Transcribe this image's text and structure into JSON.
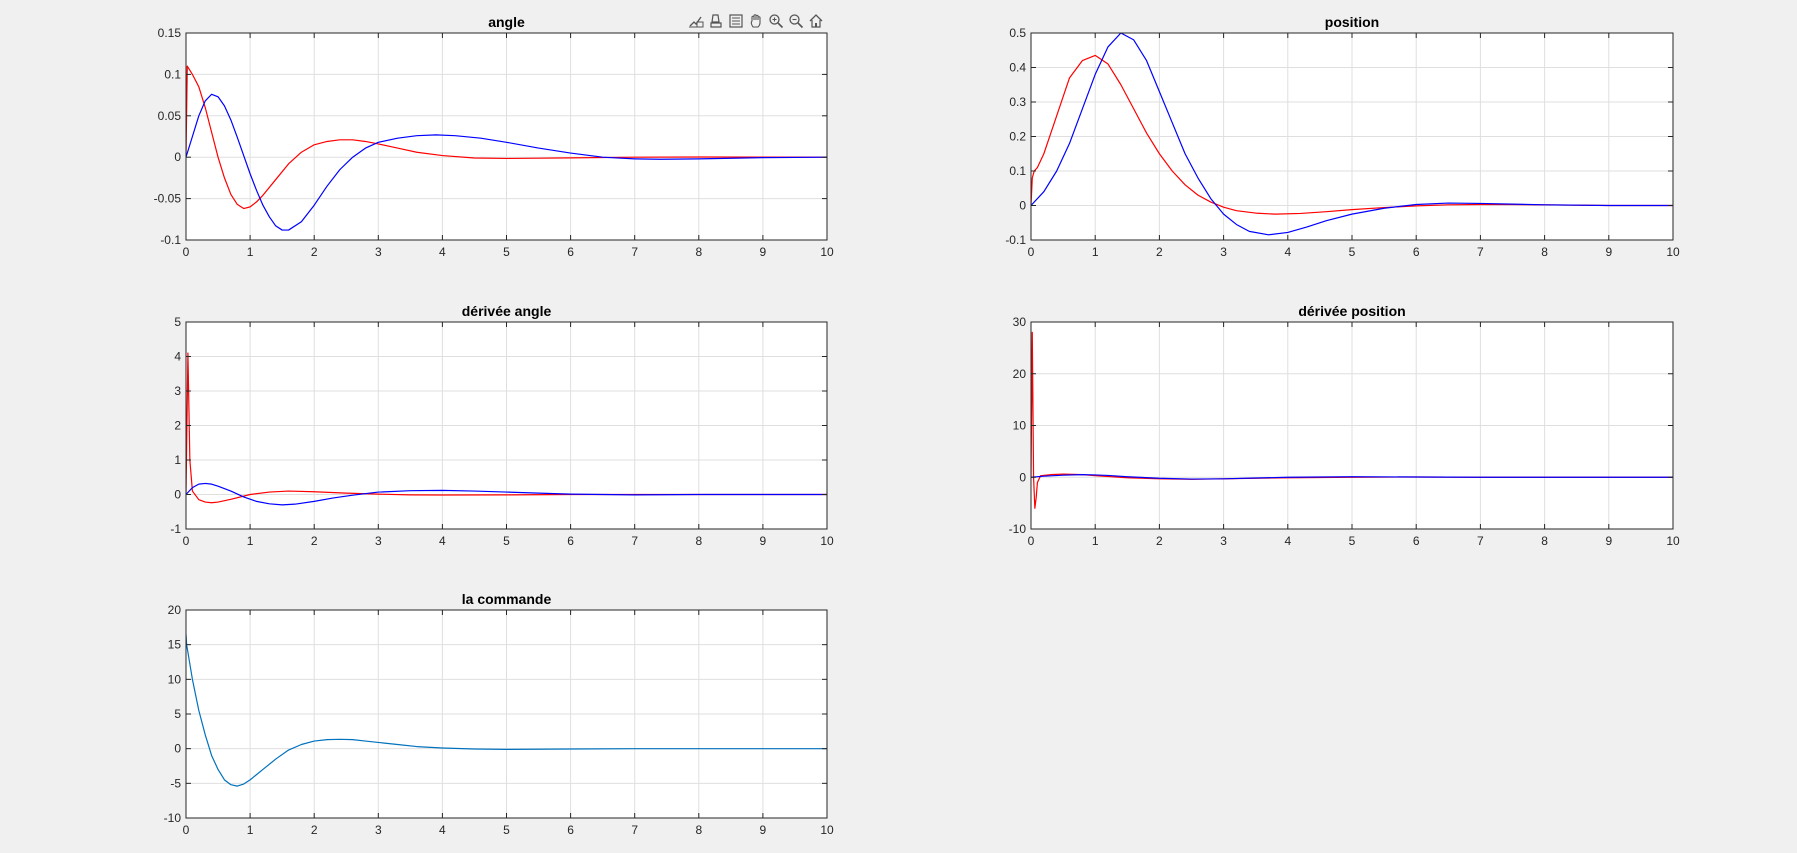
{
  "toolbar": {
    "icons": [
      "data-tips-icon",
      "brush-icon",
      "legend-icon",
      "pan-icon",
      "zoom-in-icon",
      "zoom-out-icon",
      "home-icon"
    ]
  },
  "colors": {
    "red_series": "#ff0000",
    "blue_series": "#0000ff",
    "command_series": "#0072bd",
    "grid": "#dfdfdf",
    "axes_bg": "#ffffff",
    "figure_bg": "#f0f0f0"
  },
  "chart_data": [
    {
      "id": "angle",
      "type": "line",
      "title": "angle",
      "xlabel": "",
      "ylabel": "",
      "xlim": [
        0,
        10
      ],
      "ylim": [
        -0.1,
        0.15
      ],
      "xticks": [
        0,
        1,
        2,
        3,
        4,
        5,
        6,
        7,
        8,
        9,
        10
      ],
      "yticks": [
        -0.1,
        -0.05,
        0,
        0.05,
        0.1,
        0.15
      ],
      "ytick_labels": [
        "-0.1",
        "-0.05",
        "0",
        "0.05",
        "0.1",
        "0.15"
      ],
      "grid": true,
      "series": [
        {
          "color": "#ff0000",
          "x": [
            0,
            0.02,
            0.1,
            0.2,
            0.3,
            0.4,
            0.5,
            0.6,
            0.7,
            0.8,
            0.9,
            1.0,
            1.1,
            1.2,
            1.4,
            1.6,
            1.8,
            2.0,
            2.2,
            2.4,
            2.6,
            2.8,
            3.0,
            3.3,
            3.6,
            4.0,
            4.5,
            5.0,
            5.5,
            6.0,
            7.0,
            8.0,
            9.0,
            10.0
          ],
          "y": [
            0,
            0.11,
            0.1,
            0.085,
            0.06,
            0.03,
            0.0,
            -0.025,
            -0.045,
            -0.057,
            -0.062,
            -0.06,
            -0.054,
            -0.046,
            -0.027,
            -0.008,
            0.006,
            0.015,
            0.019,
            0.021,
            0.021,
            0.019,
            0.016,
            0.011,
            0.006,
            0.002,
            -0.001,
            -0.0015,
            -0.0012,
            -0.0008,
            0.0,
            0.0002,
            0.0001,
            0.0
          ]
        },
        {
          "color": "#0000ff",
          "x": [
            0,
            0.1,
            0.2,
            0.3,
            0.4,
            0.5,
            0.6,
            0.7,
            0.8,
            0.9,
            1.0,
            1.1,
            1.2,
            1.3,
            1.4,
            1.5,
            1.6,
            1.8,
            2.0,
            2.2,
            2.4,
            2.6,
            2.8,
            3.0,
            3.3,
            3.6,
            3.9,
            4.2,
            4.6,
            5.0,
            5.5,
            6.0,
            6.5,
            7.0,
            7.4,
            8.0,
            9.0,
            10.0
          ],
          "y": [
            0,
            0.025,
            0.05,
            0.068,
            0.076,
            0.073,
            0.062,
            0.045,
            0.024,
            0.002,
            -0.02,
            -0.04,
            -0.058,
            -0.072,
            -0.083,
            -0.088,
            -0.088,
            -0.078,
            -0.058,
            -0.035,
            -0.015,
            0.0,
            0.011,
            0.018,
            0.023,
            0.026,
            0.027,
            0.026,
            0.023,
            0.018,
            0.011,
            0.005,
            0.0,
            -0.002,
            -0.0025,
            -0.002,
            -0.0005,
            0.0
          ]
        }
      ]
    },
    {
      "id": "position",
      "type": "line",
      "title": "position",
      "xlabel": "",
      "ylabel": "",
      "xlim": [
        0,
        10
      ],
      "ylim": [
        -0.1,
        0.5
      ],
      "xticks": [
        0,
        1,
        2,
        3,
        4,
        5,
        6,
        7,
        8,
        9,
        10
      ],
      "yticks": [
        -0.1,
        0,
        0.1,
        0.2,
        0.3,
        0.4,
        0.5
      ],
      "ytick_labels": [
        "-0.1",
        "0",
        "0.1",
        "0.2",
        "0.3",
        "0.4",
        "0.5"
      ],
      "grid": true,
      "series": [
        {
          "color": "#ff0000",
          "x": [
            0,
            0.02,
            0.05,
            0.1,
            0.2,
            0.4,
            0.6,
            0.8,
            1.0,
            1.2,
            1.4,
            1.6,
            1.8,
            2.0,
            2.2,
            2.4,
            2.6,
            2.8,
            3.0,
            3.2,
            3.5,
            3.8,
            4.2,
            4.6,
            5.0,
            5.5,
            6.0,
            6.5,
            7.0,
            7.5,
            8.0,
            9.0,
            10.0
          ],
          "y": [
            0,
            0.08,
            0.1,
            0.11,
            0.15,
            0.26,
            0.37,
            0.42,
            0.435,
            0.41,
            0.35,
            0.28,
            0.21,
            0.15,
            0.1,
            0.06,
            0.03,
            0.01,
            -0.005,
            -0.015,
            -0.022,
            -0.025,
            -0.023,
            -0.018,
            -0.012,
            -0.006,
            -0.001,
            0.002,
            0.003,
            0.003,
            0.002,
            0.0,
            0.0
          ]
        },
        {
          "color": "#0000ff",
          "x": [
            0,
            0.2,
            0.4,
            0.6,
            0.8,
            1.0,
            1.2,
            1.4,
            1.6,
            1.8,
            2.0,
            2.2,
            2.4,
            2.6,
            2.8,
            3.0,
            3.2,
            3.4,
            3.7,
            4.0,
            4.3,
            4.6,
            5.0,
            5.5,
            6.0,
            6.5,
            7.0,
            7.5,
            8.0,
            9.0,
            10.0
          ],
          "y": [
            0,
            0.04,
            0.1,
            0.18,
            0.28,
            0.38,
            0.46,
            0.5,
            0.48,
            0.42,
            0.33,
            0.24,
            0.15,
            0.08,
            0.02,
            -0.025,
            -0.055,
            -0.075,
            -0.085,
            -0.078,
            -0.062,
            -0.044,
            -0.025,
            -0.008,
            0.003,
            0.007,
            0.006,
            0.004,
            0.002,
            0.0,
            0.0
          ]
        }
      ]
    },
    {
      "id": "angle-derivative",
      "type": "line",
      "title": "dérivée angle",
      "xlabel": "",
      "ylabel": "",
      "xlim": [
        0,
        10
      ],
      "ylim": [
        -1,
        5
      ],
      "xticks": [
        0,
        1,
        2,
        3,
        4,
        5,
        6,
        7,
        8,
        9,
        10
      ],
      "yticks": [
        -1,
        0,
        1,
        2,
        3,
        4,
        5
      ],
      "ytick_labels": [
        "-1",
        "0",
        "1",
        "2",
        "3",
        "4",
        "5"
      ],
      "grid": true,
      "series": [
        {
          "color": "#ff0000",
          "x": [
            0,
            0.03,
            0.06,
            0.1,
            0.2,
            0.3,
            0.4,
            0.5,
            0.7,
            1.0,
            1.3,
            1.6,
            2.0,
            2.5,
            3.0,
            3.5,
            4.0,
            5.0,
            6.0,
            8.0,
            10.0
          ],
          "y": [
            0,
            4.1,
            1.0,
            0.1,
            -0.15,
            -0.22,
            -0.24,
            -0.22,
            -0.14,
            0.0,
            0.07,
            0.1,
            0.08,
            0.04,
            0.01,
            -0.01,
            -0.015,
            -0.01,
            0.0,
            0.0,
            0.0
          ]
        },
        {
          "color": "#0000ff",
          "x": [
            0,
            0.1,
            0.2,
            0.3,
            0.4,
            0.5,
            0.7,
            0.9,
            1.1,
            1.3,
            1.5,
            1.7,
            2.0,
            2.3,
            2.6,
            3.0,
            3.5,
            4.0,
            4.5,
            5.0,
            5.5,
            6.0,
            7.0,
            8.0,
            10.0
          ],
          "y": [
            0,
            0.2,
            0.3,
            0.32,
            0.3,
            0.24,
            0.1,
            -0.07,
            -0.2,
            -0.27,
            -0.3,
            -0.28,
            -0.2,
            -0.1,
            -0.02,
            0.07,
            0.11,
            0.12,
            0.1,
            0.07,
            0.04,
            0.01,
            -0.01,
            0.0,
            0.0
          ]
        }
      ]
    },
    {
      "id": "position-derivative",
      "type": "line",
      "title": "dérivée position",
      "xlabel": "",
      "ylabel": "",
      "xlim": [
        0,
        10
      ],
      "ylim": [
        -10,
        30
      ],
      "xticks": [
        0,
        1,
        2,
        3,
        4,
        5,
        6,
        7,
        8,
        9,
        10
      ],
      "yticks": [
        -10,
        0,
        10,
        20,
        30
      ],
      "ytick_labels": [
        "-10",
        "0",
        "10",
        "20",
        "30"
      ],
      "grid": true,
      "series": [
        {
          "color": "#ff0000",
          "x": [
            0,
            0.02,
            0.04,
            0.06,
            0.08,
            0.1,
            0.15,
            0.3,
            0.5,
            0.8,
            1.0,
            1.5,
            2.0,
            2.5,
            3.0,
            4.0,
            5.0,
            6.0,
            7.0,
            8.0,
            10.0
          ],
          "y": [
            0,
            28,
            0,
            -6,
            -4,
            -1,
            0.3,
            0.5,
            0.6,
            0.5,
            0.3,
            -0.1,
            -0.3,
            -0.4,
            -0.3,
            -0.1,
            0.0,
            0.05,
            0.0,
            0.0,
            0.0
          ]
        },
        {
          "color": "#0000ff",
          "x": [
            0,
            0.2,
            0.5,
            0.8,
            1.0,
            1.2,
            1.5,
            2.0,
            2.5,
            3.0,
            3.5,
            4.0,
            5.0,
            6.0,
            7.0,
            8.0,
            10.0
          ],
          "y": [
            0,
            0.2,
            0.4,
            0.5,
            0.45,
            0.35,
            0.1,
            -0.2,
            -0.35,
            -0.3,
            -0.15,
            0.0,
            0.1,
            0.05,
            0.0,
            0.0,
            0.0
          ]
        }
      ]
    },
    {
      "id": "command",
      "type": "line",
      "title": "la commande",
      "xlabel": "",
      "ylabel": "",
      "xlim": [
        0,
        10
      ],
      "ylim": [
        -10,
        20
      ],
      "xticks": [
        0,
        1,
        2,
        3,
        4,
        5,
        6,
        7,
        8,
        9,
        10
      ],
      "yticks": [
        -10,
        -5,
        0,
        5,
        10,
        15,
        20
      ],
      "ytick_labels": [
        "-10",
        "-5",
        "0",
        "5",
        "10",
        "15",
        "20"
      ],
      "grid": true,
      "series": [
        {
          "color": "#0072bd",
          "x": [
            0,
            0.01,
            0.1,
            0.2,
            0.3,
            0.4,
            0.5,
            0.6,
            0.7,
            0.8,
            0.9,
            1.0,
            1.2,
            1.4,
            1.6,
            1.8,
            2.0,
            2.2,
            2.4,
            2.6,
            2.8,
            3.0,
            3.3,
            3.6,
            4.0,
            4.5,
            5.0,
            6.0,
            7.0,
            8.0,
            10.0
          ],
          "y": [
            16.5,
            15,
            10,
            5.5,
            2,
            -1,
            -3,
            -4.5,
            -5.2,
            -5.4,
            -5.1,
            -4.5,
            -3,
            -1.5,
            -0.2,
            0.6,
            1.1,
            1.3,
            1.35,
            1.3,
            1.1,
            0.9,
            0.6,
            0.3,
            0.1,
            -0.05,
            -0.1,
            -0.05,
            0.0,
            0.0,
            0.0
          ]
        }
      ]
    }
  ]
}
